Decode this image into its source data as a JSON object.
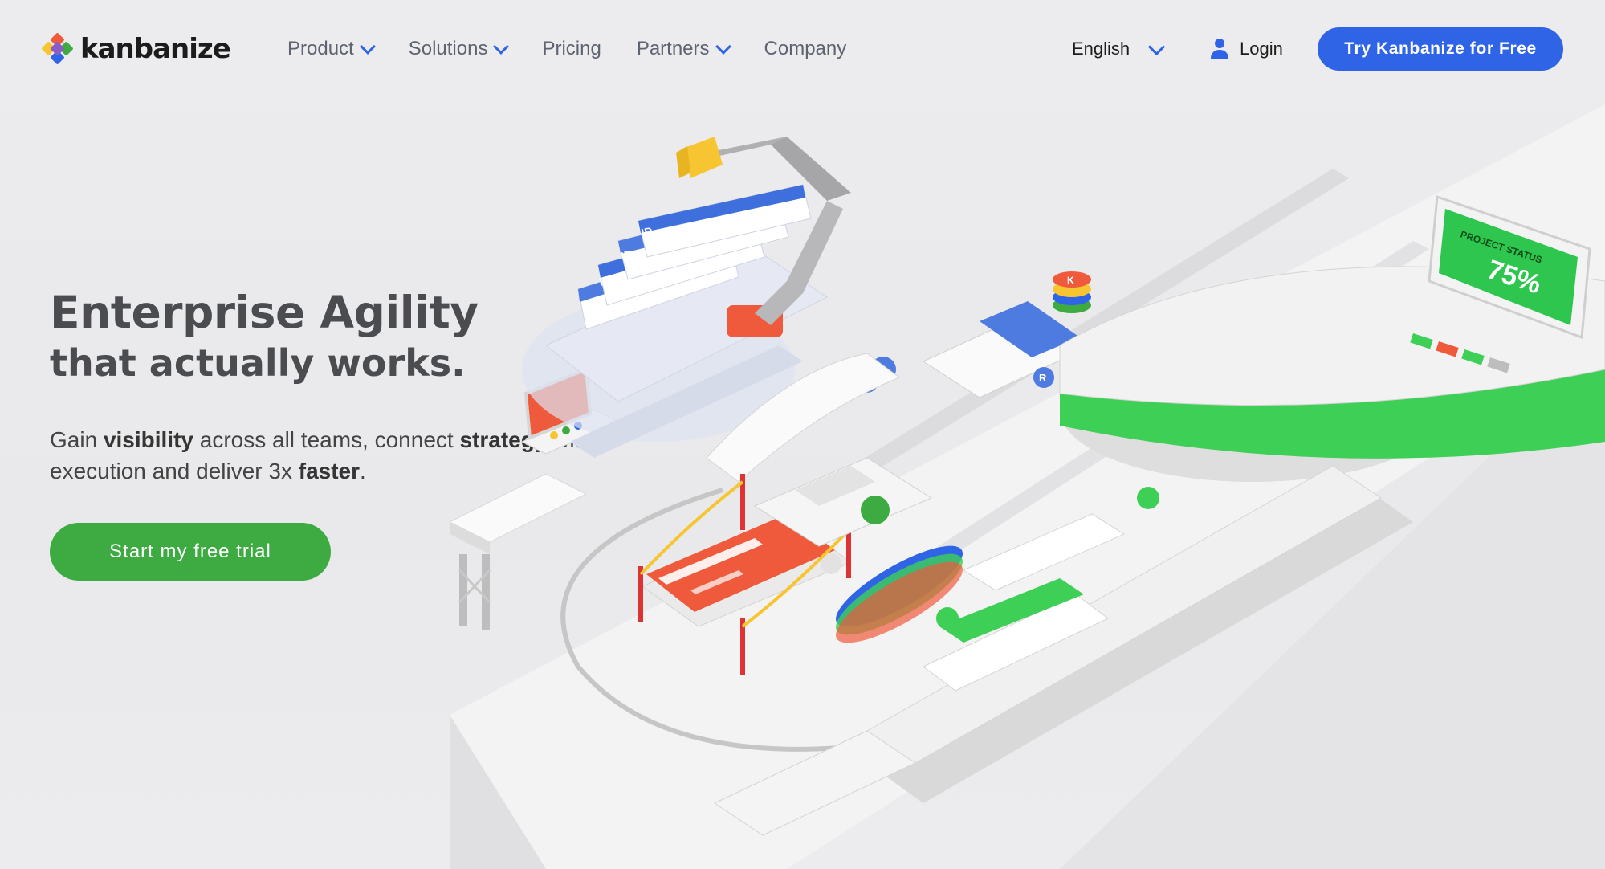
{
  "brand": {
    "name": "kanbanize"
  },
  "nav": {
    "items": [
      {
        "label": "Product",
        "dropdown": true
      },
      {
        "label": "Solutions",
        "dropdown": true
      },
      {
        "label": "Pricing",
        "dropdown": false
      },
      {
        "label": "Partners",
        "dropdown": true
      },
      {
        "label": "Company",
        "dropdown": false
      }
    ],
    "language": "English",
    "login": "Login",
    "cta": "Try Kanbanize for Free"
  },
  "hero": {
    "title": "Enterprise Agility",
    "subtitle": "that actually works.",
    "desc_parts": [
      {
        "text": "Gain ",
        "bold": false
      },
      {
        "text": "visibility",
        "bold": true
      },
      {
        "text": " across all teams, connect ",
        "bold": false
      },
      {
        "text": "strategy",
        "bold": true
      },
      {
        "text": " with execution and deliver 3x ",
        "bold": false
      },
      {
        "text": "faster",
        "bold": true
      },
      {
        "text": ".",
        "bold": false
      }
    ],
    "cta": "Start my free trial"
  },
  "illustration": {
    "status_label": "PROJECT STATUS",
    "status_value": "75%",
    "card_id_label": "ID",
    "card_badge": "R",
    "stack_badge": "K"
  },
  "colors": {
    "blue": "#2f64e6",
    "green": "#3eab42",
    "red": "#f05a3c",
    "yellow": "#f7c531"
  }
}
